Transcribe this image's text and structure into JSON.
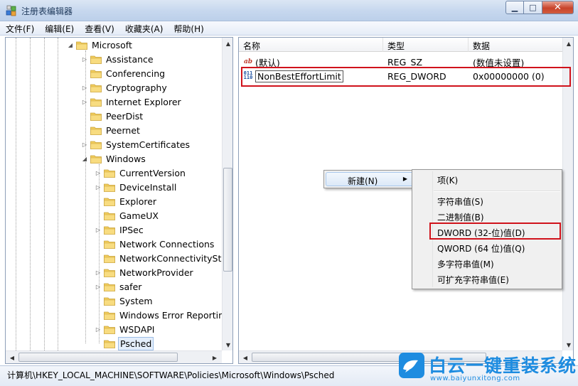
{
  "window": {
    "title": "注册表编辑器",
    "min_glyph": "▁",
    "max_glyph": "□",
    "close_glyph": "✕"
  },
  "menu": [
    "文件(F)",
    "编辑(E)",
    "查看(V)",
    "收藏夹(A)",
    "帮助(H)"
  ],
  "tree": {
    "items": [
      {
        "label": "Microsoft",
        "expander": "◢",
        "depth": 0
      },
      {
        "label": "Assistance",
        "expander": "▷",
        "depth": 1
      },
      {
        "label": "Conferencing",
        "expander": "",
        "depth": 1
      },
      {
        "label": "Cryptography",
        "expander": "▷",
        "depth": 1
      },
      {
        "label": "Internet Explorer",
        "expander": "▷",
        "depth": 1
      },
      {
        "label": "PeerDist",
        "expander": "",
        "depth": 1
      },
      {
        "label": "Peernet",
        "expander": "",
        "depth": 1
      },
      {
        "label": "SystemCertificates",
        "expander": "▷",
        "depth": 1
      },
      {
        "label": "Windows",
        "expander": "◢",
        "depth": 1
      },
      {
        "label": "CurrentVersion",
        "expander": "▷",
        "depth": 2
      },
      {
        "label": "DeviceInstall",
        "expander": "▷",
        "depth": 2
      },
      {
        "label": "Explorer",
        "expander": "",
        "depth": 2
      },
      {
        "label": "GameUX",
        "expander": "",
        "depth": 2
      },
      {
        "label": "IPSec",
        "expander": "▷",
        "depth": 2
      },
      {
        "label": "Network Connections",
        "expander": "",
        "depth": 2
      },
      {
        "label": "NetworkConnectivityStatu",
        "expander": "",
        "depth": 2
      },
      {
        "label": "NetworkProvider",
        "expander": "▷",
        "depth": 2
      },
      {
        "label": "safer",
        "expander": "▷",
        "depth": 2
      },
      {
        "label": "System",
        "expander": "",
        "depth": 2
      },
      {
        "label": "Windows Error Reporting",
        "expander": "",
        "depth": 2
      },
      {
        "label": "WSDAPI",
        "expander": "▷",
        "depth": 2
      },
      {
        "label": "Psched",
        "expander": "",
        "depth": 2,
        "selected": true
      }
    ]
  },
  "list": {
    "headers": [
      "名称",
      "类型",
      "数据"
    ],
    "rows": [
      {
        "icon": "string-value-icon",
        "icon_glyph": "ab",
        "name": "(默认)",
        "type": "REG_SZ",
        "data": "(数值未设置)"
      },
      {
        "icon": "dword-value-icon",
        "icon_glyph": "011\n110",
        "name": "NonBestEffortLimit",
        "type": "REG_DWORD",
        "data": "0x00000000 (0)",
        "editing": true
      }
    ]
  },
  "context_menu": {
    "new_label": "新建(N)",
    "submenu": [
      {
        "label": "项(K)"
      },
      {
        "separator": true
      },
      {
        "label": "字符串值(S)"
      },
      {
        "label": "二进制值(B)"
      },
      {
        "label": "DWORD (32-位)值(D)",
        "highlight": true
      },
      {
        "label": "QWORD (64 位)值(Q)"
      },
      {
        "label": "多字符串值(M)"
      },
      {
        "label": "可扩充字符串值(E)"
      }
    ]
  },
  "status": {
    "path": "计算机\\HKEY_LOCAL_MACHINE\\SOFTWARE\\Policies\\Microsoft\\Windows\\Psched"
  },
  "watermark": {
    "title": "白云一键重装系统",
    "url": "www.baiyunxitong.com"
  },
  "colors": {
    "highlight_red": "#d0121b",
    "watermark_blue": "#1e8ce0",
    "folder_yellow": "#f2cd5c"
  }
}
